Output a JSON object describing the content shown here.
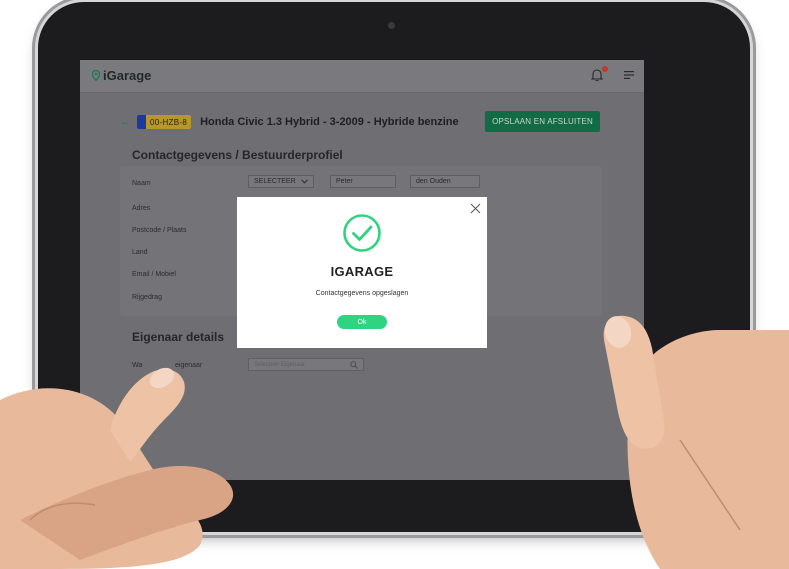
{
  "app": {
    "name": "iGarage"
  },
  "vehicle": {
    "plate": "00-HZB-8",
    "title": "Honda Civic 1.3 Hybrid - 3-2009 - Hybride benzine"
  },
  "toolbar": {
    "save_label": "OPSLAAN EN AFSLUITEN"
  },
  "contact": {
    "section_title": "Contactgegevens / Bestuurderprofiel",
    "labels": {
      "naam": "Naam",
      "adres": "Adres",
      "postcode": "Postcode / Plaats",
      "land": "Land",
      "email": "Email / Mobiel",
      "rijgedrag": "Rijgedrag"
    },
    "salutation_select": "SELECTEER",
    "first_name": "Peter",
    "last_name": "den Ouden"
  },
  "owner": {
    "section_title": "Eigenaar details",
    "label_visible_prefix": "Wa",
    "label_visible_suffix": "eigenaar",
    "search_placeholder": "Selecteer Eigenaar"
  },
  "modal": {
    "title": "IGARAGE",
    "message": "Contactgegevens opgeslagen",
    "ok_label": "Ok"
  },
  "colors": {
    "accent_green": "#2ed47f",
    "save_button": "#136b45",
    "plate_yellow": "#b6972c"
  },
  "icons": [
    "location-pin-icon",
    "bell-icon",
    "menu-icon",
    "back-arrow-icon",
    "chevron-down-icon",
    "search-icon",
    "close-icon",
    "check-circle-icon"
  ]
}
